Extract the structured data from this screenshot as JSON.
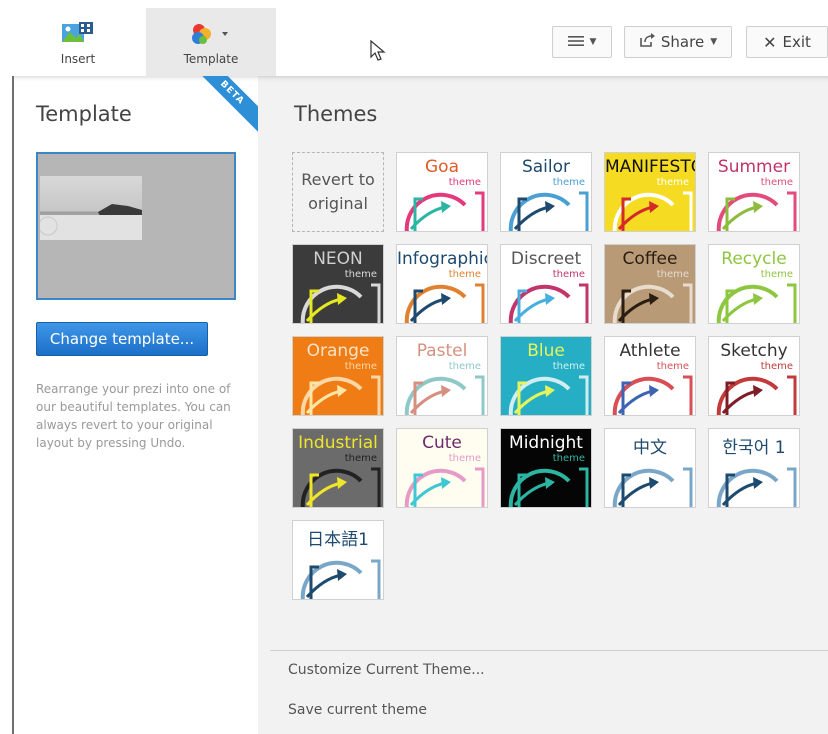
{
  "toolbar": {
    "insert_label": "Insert",
    "template_label": "Template",
    "share_label": "Share",
    "exit_label": "Exit"
  },
  "left_panel": {
    "title": "Template",
    "beta_badge": "BETA",
    "change_button": "Change template...",
    "help_text": "Rearrange your prezi into one of our beautiful templates. You can always revert to your original layout by pressing Undo."
  },
  "right_panel": {
    "title": "Themes",
    "revert_line1": "Revert to",
    "revert_line2": "original",
    "customize_link": "Customize Current Theme...",
    "save_link": "Save current theme"
  },
  "themes": [
    {
      "name": "Goa",
      "sub": "theme",
      "bg": "#ffffff",
      "fg": "#e05a2a",
      "accent": "#2bb5a3",
      "arc": "#e5387d"
    },
    {
      "name": "Sailor",
      "sub": "theme",
      "bg": "#ffffff",
      "fg": "#1d4a6e",
      "accent": "#1d4a6e",
      "arc": "#4a9fd3"
    },
    {
      "name": "MANIFESTO",
      "sub": "theme",
      "bg": "#f5dc23",
      "fg": "#111111",
      "accent": "#d42a2a",
      "arc": "#ffffff"
    },
    {
      "name": "Summer",
      "sub": "theme",
      "bg": "#ffffff",
      "fg": "#c0336a",
      "accent": "#8dbb3c",
      "arc": "#e34b7a"
    },
    {
      "name": "NEON",
      "sub": "theme",
      "bg": "#3b3b3b",
      "fg": "#cfcfcf",
      "accent": "#e5e820",
      "arc": "#d9d9d9"
    },
    {
      "name": "Infographic",
      "sub": "theme",
      "bg": "#ffffff",
      "fg": "#1d4a6e",
      "accent": "#1d4a6e",
      "arc": "#e0812f"
    },
    {
      "name": "Discreet",
      "sub": "theme",
      "bg": "#ffffff",
      "fg": "#555555",
      "accent": "#48aee0",
      "arc": "#c3346b"
    },
    {
      "name": "Coffee",
      "sub": "theme",
      "bg": "#b89a76",
      "fg": "#2b1d12",
      "accent": "#2b1d12",
      "arc": "#e7dccd"
    },
    {
      "name": "Recycle",
      "sub": "theme",
      "bg": "#ffffff",
      "fg": "#8dc63f",
      "accent": "#8dc63f",
      "arc": "#8dc63f"
    },
    {
      "name": "Orange",
      "sub": "theme",
      "bg": "#f07c15",
      "fg": "#fbe3c8",
      "accent": "#ffe6a6",
      "arc": "#fbd7a5"
    },
    {
      "name": "Pastel",
      "sub": "theme",
      "bg": "#ffffff",
      "fg": "#d7907f",
      "accent": "#d7907f",
      "arc": "#8ec9c7"
    },
    {
      "name": "Blue",
      "sub": "theme",
      "bg": "#26afc4",
      "fg": "#e6f35a",
      "accent": "#e6f35a",
      "arc": "#d0eef2"
    },
    {
      "name": "Athlete",
      "sub": "theme",
      "bg": "#ffffff",
      "fg": "#333333",
      "accent": "#3d64b3",
      "arc": "#d94f55"
    },
    {
      "name": "Sketchy",
      "sub": "theme",
      "bg": "#ffffff",
      "fg": "#333333",
      "accent": "#7d1d26",
      "arc": "#c33a3a"
    },
    {
      "name": "Industrial",
      "sub": "theme",
      "bg": "#6b6b6b",
      "fg": "#f0e629",
      "accent": "#f0e629",
      "arc": "#222222"
    },
    {
      "name": "Cute",
      "sub": "theme",
      "bg": "#fffdf0",
      "fg": "#6b2a6b",
      "accent": "#3fc8d3",
      "arc": "#e59ac7"
    },
    {
      "name": "Midnight",
      "sub": "theme",
      "bg": "#050505",
      "fg": "#ffffff",
      "accent": "#2bb5a3",
      "arc": "#2bb5a3"
    },
    {
      "name": "中文",
      "sub": "",
      "bg": "#ffffff",
      "fg": "#1d4a6e",
      "accent": "#1d4a6e",
      "arc": "#7aa7c7"
    },
    {
      "name": "한국어 1",
      "sub": "",
      "bg": "#ffffff",
      "fg": "#1d4a6e",
      "accent": "#1d4a6e",
      "arc": "#7aa7c7"
    },
    {
      "name": "日本語1",
      "sub": "",
      "bg": "#ffffff",
      "fg": "#1d4a6e",
      "accent": "#1d4a6e",
      "arc": "#7aa7c7"
    }
  ]
}
